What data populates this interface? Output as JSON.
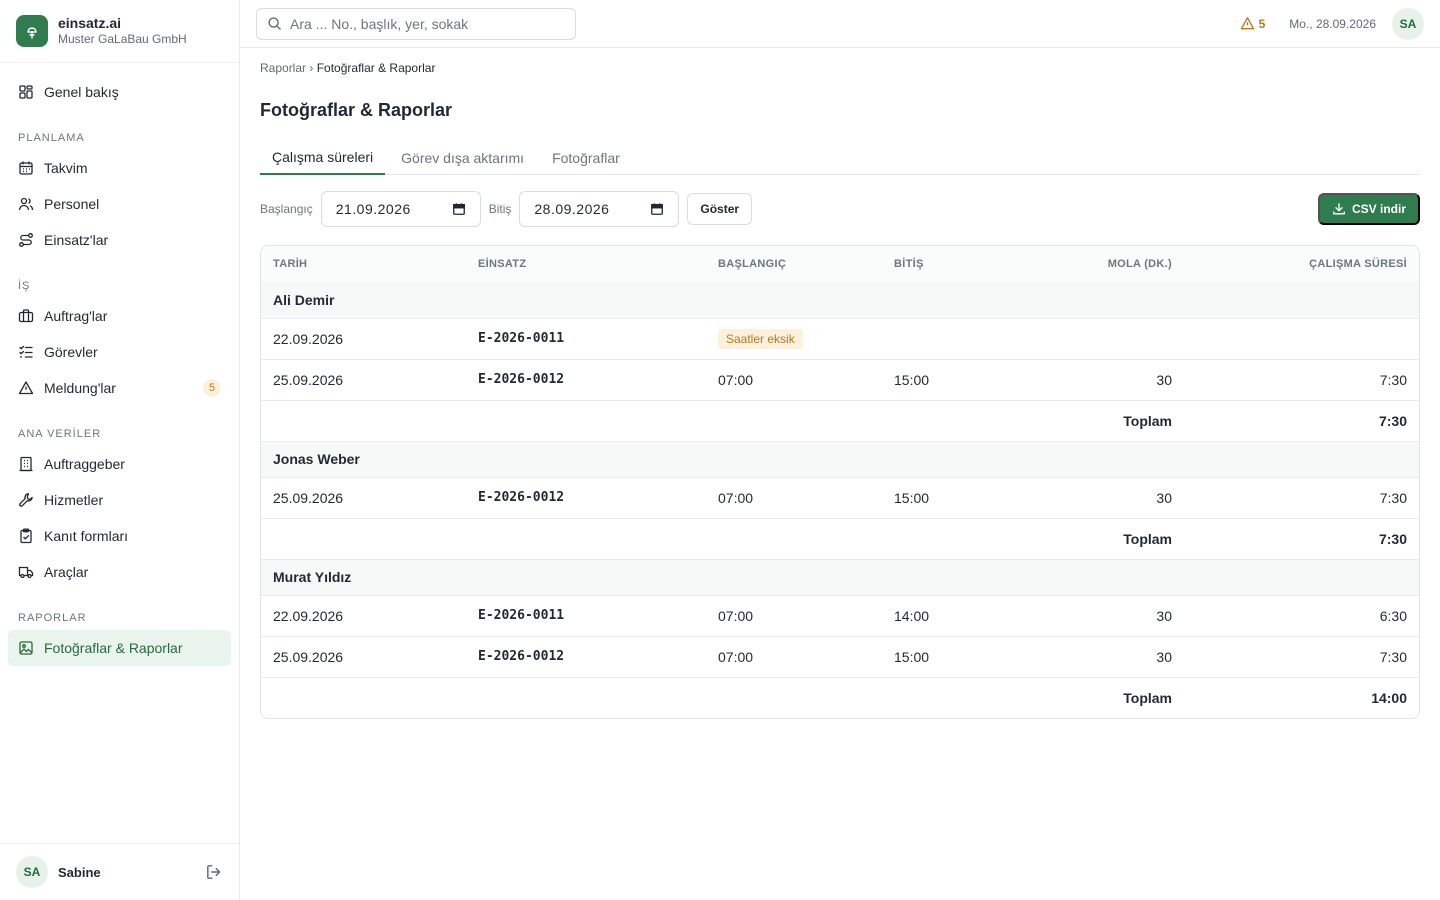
{
  "brand": {
    "name": "einsatz.ai",
    "company": "Muster GaLaBau GmbH"
  },
  "nav": {
    "overview": "Genel bakış",
    "section_planning": "PLANLAMA",
    "calendar": "Takvim",
    "staff": "Personel",
    "deployments": "Einsatz'lar",
    "section_work": "İŞ",
    "orders": "Auftrag'lar",
    "tasks": "Görevler",
    "reports_issues": "Meldung'lar",
    "reports_issues_count": "5",
    "section_master": "ANA VERİLER",
    "clients": "Auftraggeber",
    "services": "Hizmetler",
    "proof_forms": "Kanıt formları",
    "vehicles": "Araçlar",
    "section_reports": "RAPORLAR",
    "photos_reports": "Fotoğraflar & Raporlar"
  },
  "user": {
    "initials": "SA",
    "name": "Sabine"
  },
  "topbar": {
    "search_placeholder": "Ara ... No., başlık, yer, sokak",
    "warning_count": "5",
    "date": "Mo., 28.09.2026",
    "initials": "SA"
  },
  "breadcrumb": {
    "parent": "Raporlar",
    "separator": "›",
    "current": "Fotoğraflar & Raporlar"
  },
  "page_title": "Fotoğraflar & Raporlar",
  "tabs": [
    "Çalışma süreleri",
    "Görev dışa aktarımı",
    "Fotoğraflar"
  ],
  "filters": {
    "start_label": "Başlangıç",
    "start_value": "21.09.2026",
    "end_label": "Bitiş",
    "end_value": "28.09.2026",
    "show_button": "Göster",
    "csv_button": "CSV indir"
  },
  "table": {
    "headers": {
      "date": "TARİH",
      "einsatz": "EİNSATZ",
      "start": "BAŞLANGIÇ",
      "end": "BİTİŞ",
      "break": "MOLA (DK.)",
      "duration": "ÇALIŞMA SÜRESİ"
    },
    "total_label": "Toplam",
    "missing_label": "Saatler eksik",
    "groups": [
      {
        "name": "Ali Demir",
        "rows": [
          {
            "date": "22.09.2026",
            "einsatz": "E-2026-0011",
            "start": "",
            "end": "",
            "break": "",
            "duration": ""
          },
          {
            "date": "25.09.2026",
            "einsatz": "E-2026-0012",
            "start": "07:00",
            "end": "15:00",
            "break": "30",
            "duration": "7:30"
          }
        ],
        "total": "7:30"
      },
      {
        "name": "Jonas Weber",
        "rows": [
          {
            "date": "25.09.2026",
            "einsatz": "E-2026-0012",
            "start": "07:00",
            "end": "15:00",
            "break": "30",
            "duration": "7:30"
          }
        ],
        "total": "7:30"
      },
      {
        "name": "Murat Yıldız",
        "rows": [
          {
            "date": "22.09.2026",
            "einsatz": "E-2026-0011",
            "start": "07:00",
            "end": "14:00",
            "break": "30",
            "duration": "6:30"
          },
          {
            "date": "25.09.2026",
            "einsatz": "E-2026-0012",
            "start": "07:00",
            "end": "15:00",
            "break": "30",
            "duration": "7:30"
          }
        ],
        "total": "14:00"
      }
    ]
  }
}
